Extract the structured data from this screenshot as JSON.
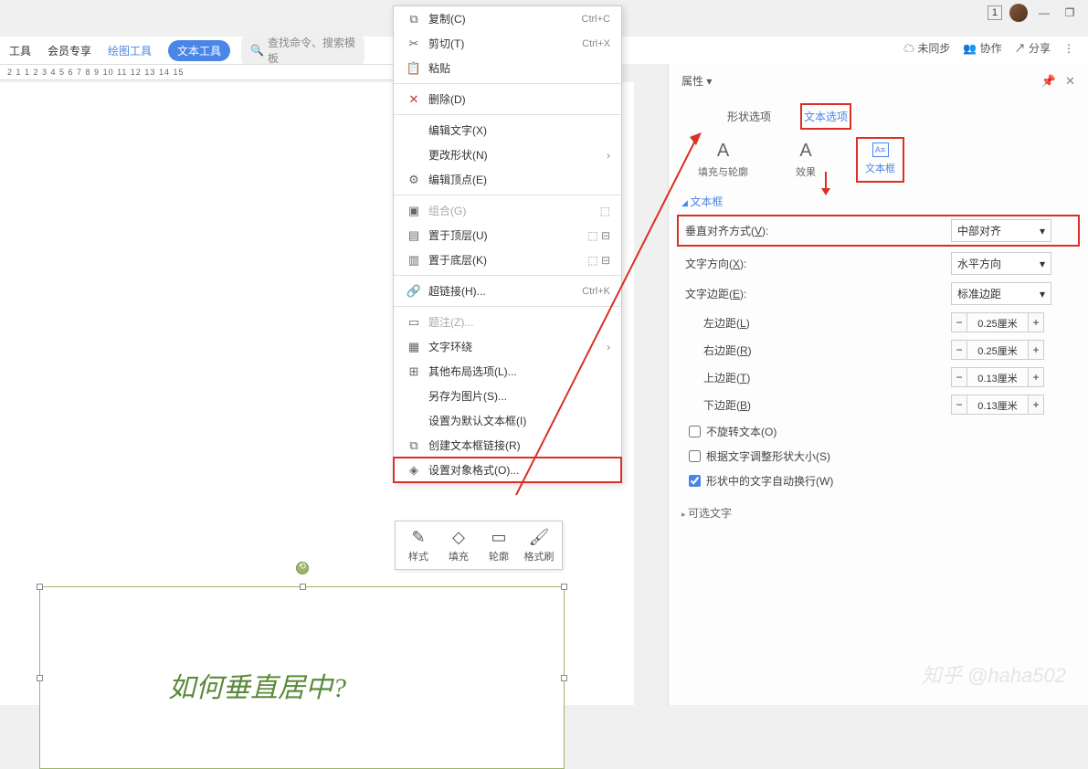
{
  "topbar": {
    "badge": "1"
  },
  "secondbar": {
    "tab_tools": "工具",
    "tab_member": "会员专享",
    "tab_draw": "绘图工具",
    "tab_text": "文本工具",
    "search_placeholder": "查找命令、搜索模板"
  },
  "right_actions": {
    "unsync": "未同步",
    "collab": "协作",
    "share": "分享"
  },
  "ruler_text": "2    1     1    2    3    4    5    6    7    8    9    10   11   12   13   14   15",
  "context_menu": {
    "copy": "复制(C)",
    "copy_sc": "Ctrl+C",
    "cut": "剪切(T)",
    "cut_sc": "Ctrl+X",
    "paste": "粘贴",
    "delete": "删除(D)",
    "edit_text": "编辑文字(X)",
    "change_shape": "更改形状(N)",
    "edit_points": "编辑顶点(E)",
    "group": "组合(G)",
    "bring_front": "置于顶层(U)",
    "send_back": "置于底层(K)",
    "hyperlink": "超链接(H)...",
    "hyperlink_sc": "Ctrl+K",
    "caption": "题注(Z)...",
    "wrap": "文字环绕",
    "layout": "其他布局选项(L)...",
    "save_pic": "另存为图片(S)...",
    "default_tb": "设置为默认文本框(I)",
    "link_tb": "创建文本框链接(R)",
    "format_obj": "设置对象格式(O)..."
  },
  "mini_toolbar": {
    "style": "样式",
    "fill": "填充",
    "outline": "轮廓",
    "format": "格式刷"
  },
  "textbox_text": "如何垂直居中?",
  "panel": {
    "title": "属性",
    "tab_shape": "形状选项",
    "tab_text": "文本选项",
    "sub_fill": "填充与轮廓",
    "sub_effect": "效果",
    "sub_textbox": "文本框",
    "section_textbox": "文本框",
    "valign_label": "垂直对齐方式(",
    "valign_key": "V",
    "valign_suffix": "):",
    "valign_value": "中部对齐",
    "textdir_label": "文字方向(",
    "textdir_key": "X",
    "textdir_suffix": "):",
    "textdir_value": "水平方向",
    "margin_label": "文字边距(",
    "margin_key": "E",
    "margin_suffix": "):",
    "margin_value": "标准边距",
    "left_margin": "左边距(",
    "left_key": "L",
    "left_val": "0.25厘米",
    "right_margin": "右边距(",
    "right_key": "R",
    "right_val": "0.25厘米",
    "top_margin": "上边距(",
    "top_key": "T",
    "top_val": "0.13厘米",
    "bottom_margin": "下边距(",
    "bottom_key": "B",
    "bottom_val": "0.13厘米",
    "norotate": "不旋转文本(",
    "norotate_key": "O",
    "autofit": "根据文字调整形状大小(",
    "autofit_key": "S",
    "wrap_shape": "形状中的文字自动换行(",
    "wrap_key": "W",
    "opt_text": "可选文字"
  },
  "watermark": "知乎 @haha502"
}
